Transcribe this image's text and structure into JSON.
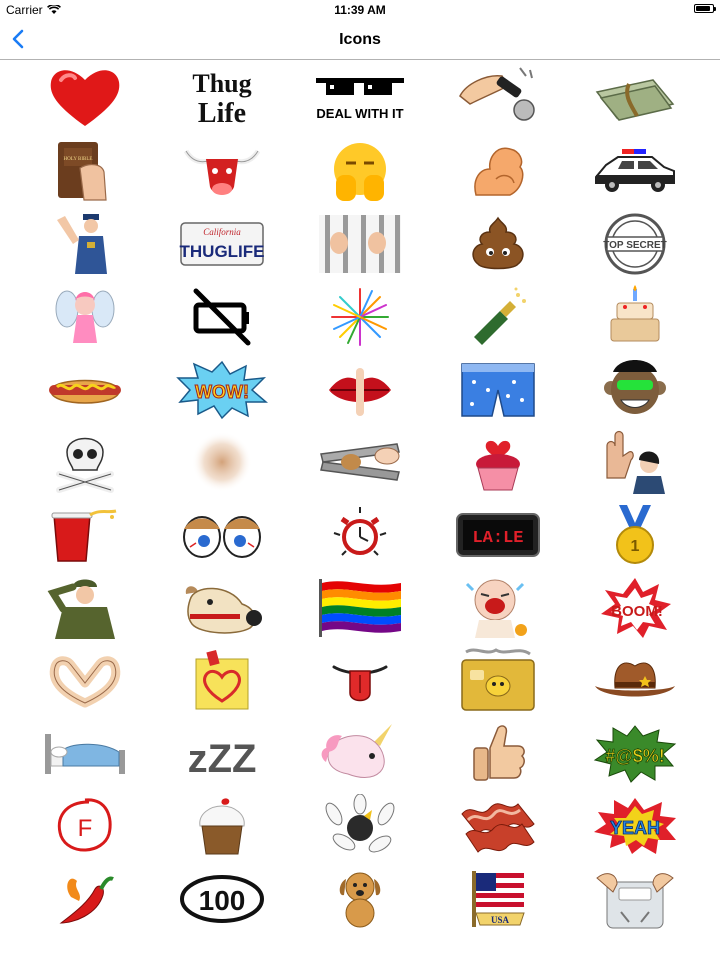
{
  "status_bar": {
    "carrier": "Carrier",
    "time": "11:39 AM",
    "battery_level": 0.9
  },
  "nav": {
    "title": "Icons",
    "back_icon": "chevron-left-icon"
  },
  "colors": {
    "accent": "#1a7cf5",
    "divider": "#b2b2b2"
  },
  "icon_text": {
    "thug_line1": "Thug",
    "thug_line2": "Life",
    "deal_with_it": "DEAL WITH IT",
    "bible_label": "HOLY BIBLE",
    "plate_state": "California",
    "plate_text": "THUGLIFE",
    "top_secret": "TOP SECRET",
    "wow": "WOW!",
    "clock_display": "LA:LE",
    "medal_number": "1",
    "boom": "BOOM!",
    "grade": "F",
    "zzz": "zZZ",
    "curse": "#@$%!",
    "yeah": "YEAH",
    "hundred": "100",
    "usa": "USA"
  },
  "icons": [
    "heart-icon",
    "thug-life-icon",
    "deal-with-it-icon",
    "mic-drop-icon",
    "money-roll-icon",
    "hand-on-bible-icon",
    "bull-head-icon",
    "hiding-emoji-icon",
    "flexed-bicep-icon",
    "police-car-icon",
    "police-officer-icon",
    "thuglife-license-plate-icon",
    "jail-bars-icon",
    "poop-icon",
    "top-secret-stamp-icon",
    "fairy-icon",
    "empty-battery-icon",
    "fireworks-icon",
    "champagne-icon",
    "birthday-cake-icon",
    "hot-dog-icon",
    "wow-burst-icon",
    "shush-lips-icon",
    "boxer-shorts-icon",
    "monkey-icon",
    "skull-crossbones-icon",
    "blurred-icon",
    "nutcracker-icon",
    "cupcake-heart-icon",
    "talk-to-hand-icon",
    "red-cup-icon",
    "tired-eyes-icon",
    "alarm-clock-icon",
    "digital-clock-icon",
    "gold-medal-icon",
    "saluting-soldier-icon",
    "bulldog-icon",
    "rainbow-flag-icon",
    "crying-baby-icon",
    "boom-burst-icon",
    "heart-hands-icon",
    "heart-note-icon",
    "tongue-out-icon",
    "credit-card-icon",
    "cowboy-hat-icon",
    "bed-icon",
    "zzz-sleep-icon",
    "unicorn-icon",
    "thumbs-up-icon",
    "curse-burst-icon",
    "f-grade-icon",
    "cupcake-icon",
    "bowling-strike-icon",
    "bacon-icon",
    "yeah-burst-icon",
    "chili-pepper-icon",
    "hundred-icon",
    "puppy-icon",
    "usa-flag-icon",
    "scale-icon"
  ]
}
